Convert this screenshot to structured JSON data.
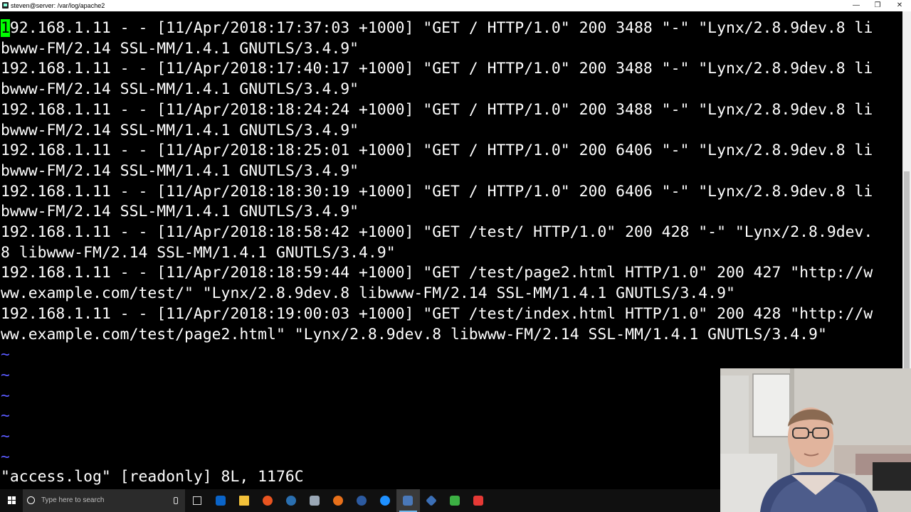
{
  "window": {
    "title": "steven@server: /var/log/apache2"
  },
  "terminal": {
    "lines": [
      "192.168.1.11 - - [11/Apr/2018:17:37:03 +1000] \"GET / HTTP/1.0\" 200 3488 \"-\" \"Lynx/2.8.9dev.8 li",
      "bwww-FM/2.14 SSL-MM/1.4.1 GNUTLS/3.4.9\"",
      "192.168.1.11 - - [11/Apr/2018:17:40:17 +1000] \"GET / HTTP/1.0\" 200 3488 \"-\" \"Lynx/2.8.9dev.8 li",
      "bwww-FM/2.14 SSL-MM/1.4.1 GNUTLS/3.4.9\"",
      "192.168.1.11 - - [11/Apr/2018:18:24:24 +1000] \"GET / HTTP/1.0\" 200 3488 \"-\" \"Lynx/2.8.9dev.8 li",
      "bwww-FM/2.14 SSL-MM/1.4.1 GNUTLS/3.4.9\"",
      "192.168.1.11 - - [11/Apr/2018:18:25:01 +1000] \"GET / HTTP/1.0\" 200 6406 \"-\" \"Lynx/2.8.9dev.8 li",
      "bwww-FM/2.14 SSL-MM/1.4.1 GNUTLS/3.4.9\"",
      "192.168.1.11 - - [11/Apr/2018:18:30:19 +1000] \"GET / HTTP/1.0\" 200 6406 \"-\" \"Lynx/2.8.9dev.8 li",
      "bwww-FM/2.14 SSL-MM/1.4.1 GNUTLS/3.4.9\"",
      "192.168.1.11 - - [11/Apr/2018:18:58:42 +1000] \"GET /test/ HTTP/1.0\" 200 428 \"-\" \"Lynx/2.8.9dev.",
      "8 libwww-FM/2.14 SSL-MM/1.4.1 GNUTLS/3.4.9\"",
      "192.168.1.11 - - [11/Apr/2018:18:59:44 +1000] \"GET /test/page2.html HTTP/1.0\" 200 427 \"http://w",
      "ww.example.com/test/\" \"Lynx/2.8.9dev.8 libwww-FM/2.14 SSL-MM/1.4.1 GNUTLS/3.4.9\"",
      "192.168.1.11 - - [11/Apr/2018:19:00:03 +1000] \"GET /test/index.html HTTP/1.0\" 200 428 \"http://w",
      "ww.example.com/test/page2.html\" \"Lynx/2.8.9dev.8 libwww-FM/2.14 SSL-MM/1.4.1 GNUTLS/3.4.9\""
    ],
    "tilde": "~",
    "status_line": "\"access.log\" [readonly] 8L, 1176C"
  },
  "taskbar": {
    "search_placeholder": "Type here to search"
  },
  "colors": {
    "background": "#000000",
    "text": "#ffffff",
    "tilde": "#5a5aff",
    "cursor": "#00ff00"
  }
}
